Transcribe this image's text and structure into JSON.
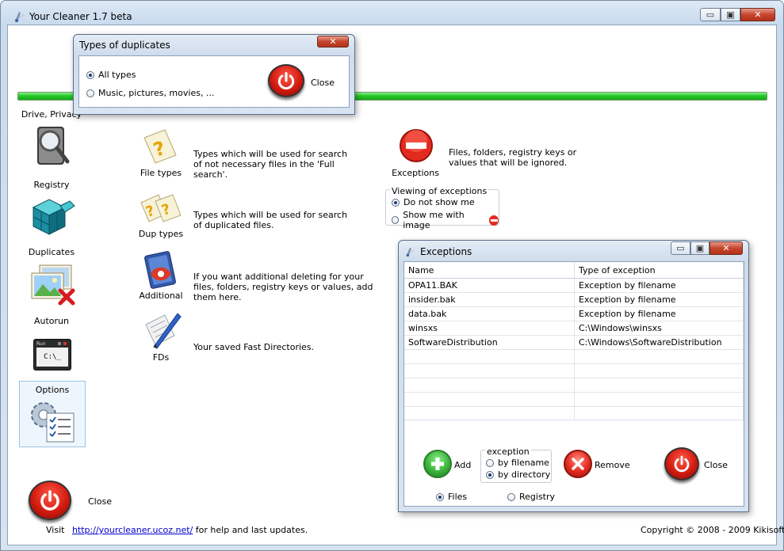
{
  "main": {
    "title": "Your Cleaner 1.7 beta",
    "caption": {
      "minimize": "▭",
      "maximize": "▣",
      "close": "✕"
    },
    "progress_fraction": 1.0,
    "sidebar": [
      {
        "label": "Drive, Privacy",
        "icon": "drive-privacy-icon"
      },
      {
        "label": "Registry",
        "icon": "registry-icon"
      },
      {
        "label": "Duplicates",
        "icon": "duplicates-icon"
      },
      {
        "label": "Autorun",
        "icon": "autorun-icon"
      },
      {
        "label": "Options",
        "icon": "options-icon"
      }
    ],
    "run_icon": {
      "title": "Run",
      "text": "C:\\_"
    },
    "options_panel": [
      {
        "label": "File types",
        "desc": "Types which will be used for search of not necessary files in the 'Full search'."
      },
      {
        "label": "Dup types",
        "desc": "Types which will be used for search of duplicated files."
      },
      {
        "label": "Additional",
        "desc": "If you want additional deleting for your files, folders, registry keys or values, add them here."
      },
      {
        "label": "FDs",
        "desc": "Your saved Fast Directories."
      }
    ],
    "exceptions": {
      "label": "Exceptions",
      "desc": "Files, folders, registry keys or values that will be ignored.",
      "viewing": {
        "title": "Viewing of exceptions",
        "options": [
          "Do not show me",
          "Show me with image"
        ],
        "selected": 0
      }
    },
    "close_label": "Close",
    "footer": {
      "visit": "Visit",
      "url": "http://yourcleaner.ucoz.net/",
      "after": "for help and last updates.",
      "copyright": "Copyright © 2008 - 2009 Kikisoft"
    }
  },
  "dup_dialog": {
    "title": "Types of duplicates",
    "close_btn": "✕",
    "options": [
      "All types",
      "Music, pictures, movies, ..."
    ],
    "selected": 0,
    "close_label": "Close"
  },
  "exceptions_dialog": {
    "title": "Exceptions",
    "caption": {
      "minimize": "▭",
      "maximize": "▣",
      "close": "✕"
    },
    "columns": [
      "Name",
      "Type of exception"
    ],
    "rows": [
      [
        "OPA11.BAK",
        "Exception by filename"
      ],
      [
        "insider.bak",
        "Exception by filename"
      ],
      [
        "data.bak",
        "Exception by filename"
      ],
      [
        "winsxs",
        "C:\\Windows\\winsxs"
      ],
      [
        "SoftwareDistribution",
        "C:\\Windows\\SoftwareDistribution"
      ]
    ],
    "add_label": "Add",
    "exception_group": {
      "title": "exception",
      "options": [
        "by filename",
        "by directory"
      ],
      "selected": 1
    },
    "remove_label": "Remove",
    "close_label": "Close",
    "target": {
      "options": [
        "Files",
        "Registry"
      ],
      "selected": 0
    }
  },
  "colors": {
    "progress": "#22c722",
    "link": "#0000cc",
    "power_red": "#d41b10",
    "add_green": "#3bb33b"
  }
}
